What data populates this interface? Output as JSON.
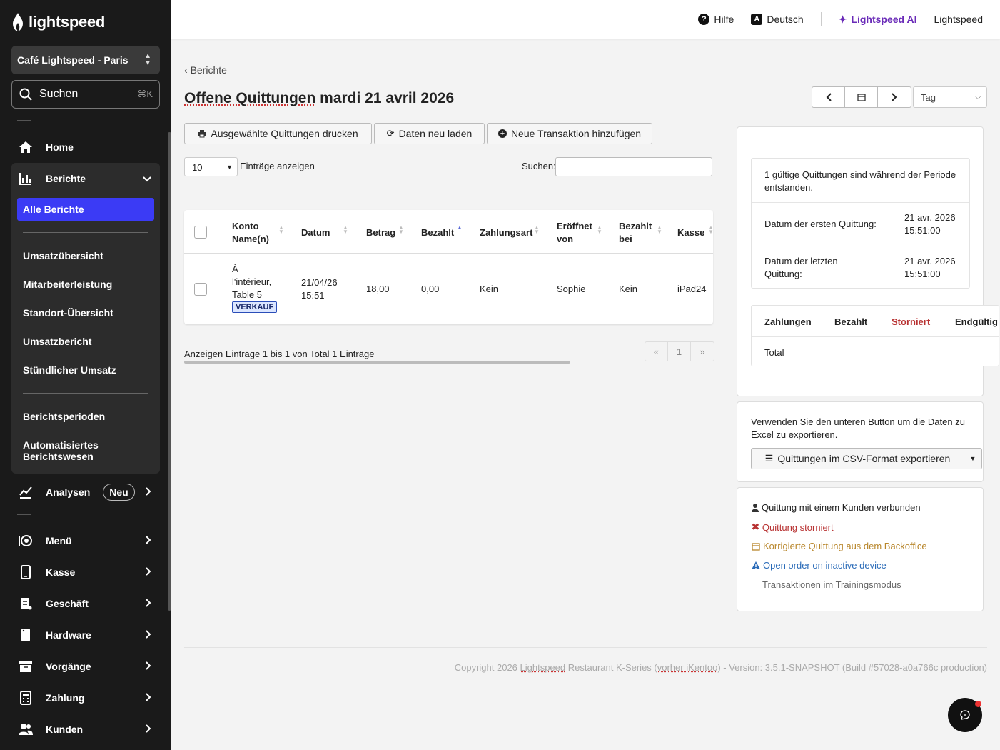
{
  "sidebar": {
    "logo_text": "lightspeed",
    "store": "Café Lightspeed - Paris",
    "search_label": "Suchen",
    "search_shortcut": "⌘K",
    "home": "Home",
    "berichte": "Berichte",
    "sub": {
      "active": "Alle Berichte",
      "items": [
        "Umsatzübersicht",
        "Mitarbeiterleistung",
        "Standort-Übersicht",
        "Umsatzbericht",
        "Stündlicher Umsatz"
      ],
      "items2": [
        "Berichtsperioden",
        "Automatisiertes Berichtswesen"
      ]
    },
    "analysen": "Analysen",
    "analysen_badge": "Neu",
    "menu": [
      "Menü",
      "Kasse",
      "Geschäft",
      "Hardware",
      "Vorgänge",
      "Zahlung",
      "Kunden"
    ]
  },
  "topbar": {
    "hilfe": "Hilfe",
    "sprache": "Deutsch",
    "ai": "Lightspeed AI",
    "account": "Lightspeed"
  },
  "main": {
    "breadcrumb": "Berichte",
    "title_u": "Offene Quittungen",
    "title_rest": " mardi 21 avril 2026",
    "period_select": "Tag",
    "btn_print": "Ausgewählte Quittungen drucken",
    "btn_reload": "Daten neu laden",
    "btn_new": "Neue Transaktion hinzufügen",
    "length_value": "10",
    "length_label": "Einträge anzeigen",
    "search_label": "Suchen:",
    "columns": {
      "konto": "Konto Name(n)",
      "datum": "Datum",
      "betrag": "Betrag",
      "bezahlt": "Bezahlt",
      "zahlungsart": "Zahlungsart",
      "eroeffnet": "Eröffnet von",
      "bezahlt_bei": "Bezahlt bei",
      "kasse": "Kasse"
    },
    "row": {
      "konto": "À l'intérieur, Table 5",
      "tag": "VERKAUF",
      "datum": "21/04/26 15:51",
      "betrag": "18,00",
      "bezahlt": "0,00",
      "zahlungsart": "Kein",
      "eroeffnet": "Sophie",
      "bezahlt_bei": "Kein",
      "kasse": "iPad24"
    },
    "info": "Anzeigen Einträge 1 bis 1 von Total 1 Einträge",
    "pager": [
      "«",
      "1",
      "»"
    ]
  },
  "summary": {
    "line1": "1 gültige Quittungen sind während der Periode entstanden.",
    "first_label": "Datum der ersten Quittung:",
    "first_value": "21 avr. 2026 15:51:00",
    "last_label": "Datum der letzten Quittung:",
    "last_value": "21 avr. 2026 15:51:00",
    "pay_headers": [
      "Zahlungen",
      "Bezahlt",
      "Storniert",
      "Endgültig"
    ],
    "total": "Total"
  },
  "export": {
    "text": "Verwenden Sie den unteren Button um die Daten zu Excel zu exportieren.",
    "button": "Quittungen im CSV-Format exportieren"
  },
  "legend": [
    "Quittung mit einem Kunden verbunden",
    "Quittung storniert",
    "Korrigierte Quittung aus dem Backoffice",
    "Open order on inactive device",
    "Transaktionen im Trainingsmodus"
  ],
  "footer": {
    "pre": "Copyright 2026 ",
    "brand": "Lightspeed",
    "mid": " Restaurant K-Series (",
    "old": "vorher iKentoo",
    "post": ") - Version: 3.5.1-SNAPSHOT (Build #57028-a0a766c production)"
  },
  "colors": {
    "accent": "#3b3bf5",
    "sidebar": "#1a1a1a",
    "ai": "#6a2bb8",
    "storniert": "#b83232",
    "korrigiert": "#b8862b",
    "inactive": "#2a6bb8"
  }
}
